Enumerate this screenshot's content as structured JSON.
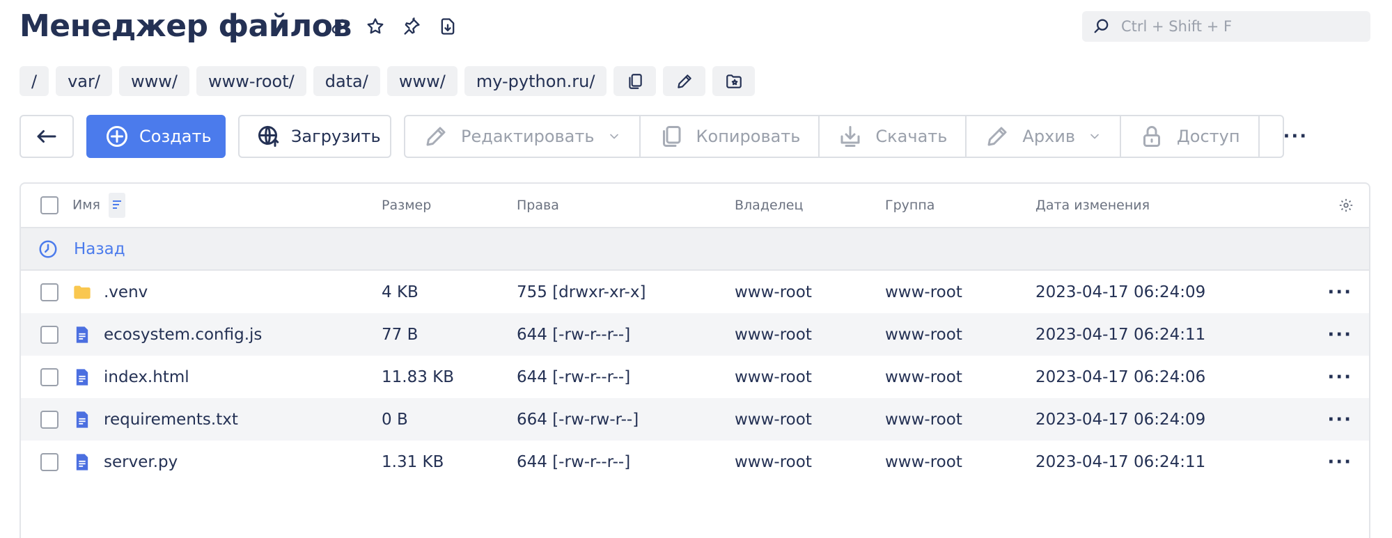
{
  "header": {
    "title": "Менеджер файлов",
    "icons": [
      "link-icon",
      "star-icon",
      "pin-icon",
      "download-file-icon"
    ]
  },
  "search": {
    "placeholder": "Ctrl + Shift + F",
    "value": ""
  },
  "breadcrumb": {
    "items": [
      "/",
      "var/",
      "www/",
      "www-root/",
      "data/",
      "www/",
      "my-python.ru/"
    ],
    "actions": [
      "copy-icon",
      "pencil-icon",
      "folder-star-icon"
    ]
  },
  "toolbar": {
    "create_label": "Создать",
    "upload_label": "Загрузить",
    "edit_label": "Редактировать",
    "copy_label": "Копировать",
    "download_label": "Скачать",
    "archive_label": "Архив",
    "access_label": "Доступ",
    "more_label": "···"
  },
  "table": {
    "columns": {
      "name": "Имя",
      "size": "Размер",
      "perms": "Права",
      "owner": "Владелец",
      "group": "Группа",
      "date": "Дата изменения"
    },
    "back_label": "Назад",
    "row_menu": "···",
    "rows": [
      {
        "type": "folder",
        "name": ".venv",
        "size": "4 KB",
        "perms": "755 [drwxr-xr-x]",
        "owner": "www-root",
        "group": "www-root",
        "date": "2023-04-17 06:24:09"
      },
      {
        "type": "file",
        "name": "ecosystem.config.js",
        "size": "77 B",
        "perms": "644 [-rw-r--r--]",
        "owner": "www-root",
        "group": "www-root",
        "date": "2023-04-17 06:24:11"
      },
      {
        "type": "file",
        "name": "index.html",
        "size": "11.83 KB",
        "perms": "644 [-rw-r--r--]",
        "owner": "www-root",
        "group": "www-root",
        "date": "2023-04-17 06:24:06"
      },
      {
        "type": "file",
        "name": "requirements.txt",
        "size": "0 B",
        "perms": "664 [-rw-rw-r--]",
        "owner": "www-root",
        "group": "www-root",
        "date": "2023-04-17 06:24:09"
      },
      {
        "type": "file",
        "name": "server.py",
        "size": "1.31 KB",
        "perms": "644 [-rw-r--r--]",
        "owner": "www-root",
        "group": "www-root",
        "date": "2023-04-17 06:24:11"
      }
    ]
  },
  "colors": {
    "accent": "#4b7bec",
    "folder": "#f9c74f",
    "file": "#4b6fe0",
    "text": "#243154",
    "muted": "#9aa0ab"
  }
}
